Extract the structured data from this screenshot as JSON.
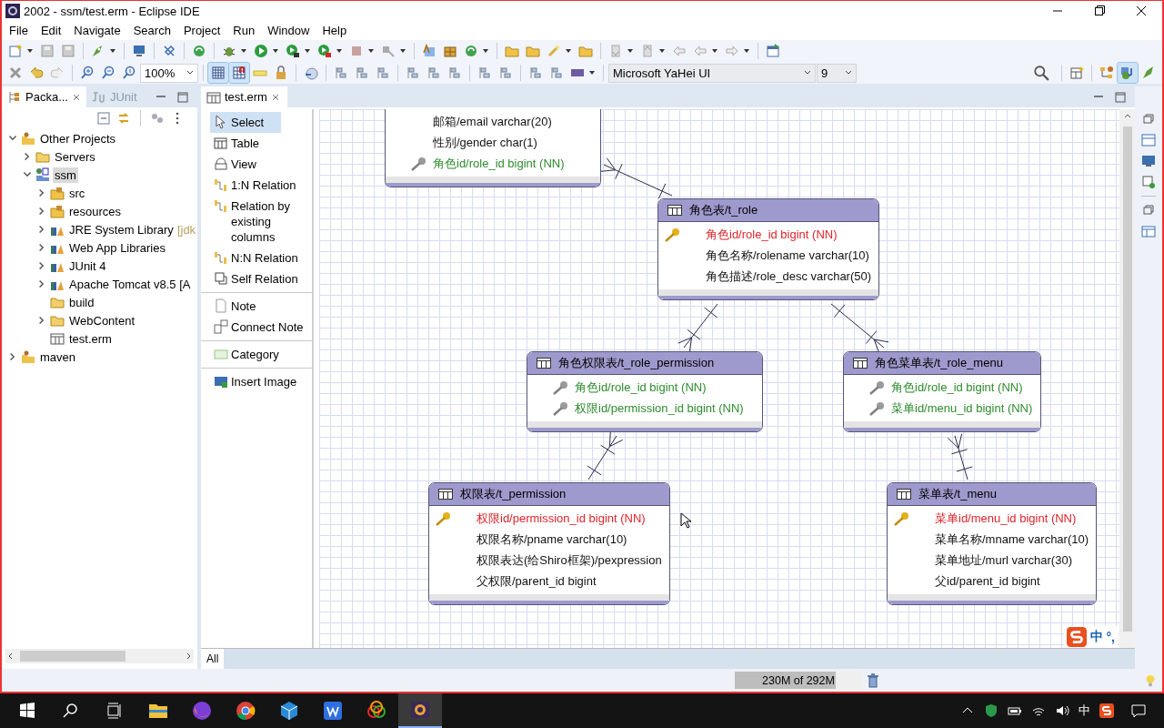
{
  "window": {
    "title": "2002 - ssm/test.erm - Eclipse IDE"
  },
  "menu": [
    "File",
    "Edit",
    "Navigate",
    "Search",
    "Project",
    "Run",
    "Window",
    "Help"
  ],
  "toolbar": {
    "zoom": "100%",
    "grid_shown": true,
    "snap_to_grid": true,
    "font": "Microsoft YaHei UI",
    "font_size": "9"
  },
  "perspectives": [
    {
      "selected": false
    },
    {
      "selected": true
    },
    {
      "selected": false
    }
  ],
  "left_tabs": [
    {
      "label": "Packa...",
      "selected": true
    },
    {
      "label": "JUnit",
      "selected": false
    }
  ],
  "tree": [
    {
      "label": "Other Projects",
      "kind": "working-set",
      "expanded": true,
      "selected": false,
      "children": [
        {
          "label": "Servers",
          "kind": "folder",
          "expanded": false,
          "selected": false
        },
        {
          "label": "ssm",
          "kind": "project",
          "expanded": true,
          "selected": true,
          "children": [
            {
              "label": "src",
              "kind": "package",
              "expanded": false,
              "selected": false
            },
            {
              "label": "resources",
              "kind": "package",
              "expanded": false,
              "selected": false
            },
            {
              "label": "JRE System Library",
              "decoration": "[jdk",
              "kind": "library",
              "expanded": false,
              "selected": false
            },
            {
              "label": "Web App Libraries",
              "kind": "library",
              "expanded": false,
              "selected": false
            },
            {
              "label": "JUnit 4",
              "kind": "library",
              "expanded": false,
              "selected": false
            },
            {
              "label": "Apache Tomcat v8.5 [A",
              "kind": "library",
              "expanded": false,
              "selected": false
            },
            {
              "label": "build",
              "kind": "folder",
              "selected": false
            },
            {
              "label": "WebContent",
              "kind": "folder",
              "expanded": false,
              "selected": false
            },
            {
              "label": "test.erm",
              "kind": "erm",
              "selected": false
            }
          ]
        }
      ]
    },
    {
      "label": "maven",
      "kind": "working-set",
      "expanded": false,
      "selected": false
    }
  ],
  "editor_tab": {
    "label": "test.erm",
    "selected": true
  },
  "palette": [
    [
      {
        "label": "Select",
        "kind": "select",
        "selected": true
      },
      {
        "label": "Table",
        "kind": "table",
        "selected": false
      },
      {
        "label": "View",
        "kind": "view",
        "selected": false
      },
      {
        "label": "1:N Relation",
        "kind": "relation",
        "selected": false
      },
      {
        "label": "Relation by existing columns",
        "kind": "relation",
        "selected": false
      },
      {
        "label": "N:N Relation",
        "kind": "nn",
        "selected": false
      },
      {
        "label": "Self Relation",
        "kind": "self",
        "selected": false
      }
    ],
    [
      {
        "label": "Note",
        "kind": "note",
        "selected": false
      },
      {
        "label": "Connect Note",
        "kind": "connect",
        "selected": false
      }
    ],
    [
      {
        "label": "Category",
        "kind": "category",
        "selected": false
      }
    ],
    [
      {
        "label": "Insert Image",
        "kind": "image",
        "selected": false
      }
    ]
  ],
  "tables": [
    {
      "columns": [
        {
          "text": "邮箱/email varchar(20)",
          "kind": "normal"
        },
        {
          "text": "性别/gender char(1)",
          "kind": "normal"
        },
        {
          "text": "角色id/role_id bigint (NN)",
          "kind": "fk"
        }
      ]
    },
    {
      "name": "角色表/t_role",
      "columns": [
        {
          "text": "角色id/role_id bigint (NN)",
          "kind": "pk"
        },
        {
          "text": "角色名称/rolename varchar(10)",
          "kind": "normal"
        },
        {
          "text": "角色描述/role_desc varchar(50)",
          "kind": "normal"
        }
      ]
    },
    {
      "name": "角色权限表/t_role_permission",
      "columns": [
        {
          "text": "角色id/role_id bigint (NN)",
          "kind": "fk"
        },
        {
          "text": "权限id/permission_id bigint (NN)",
          "kind": "fk"
        }
      ]
    },
    {
      "name": "角色菜单表/t_role_menu",
      "columns": [
        {
          "text": "角色id/role_id bigint (NN)",
          "kind": "fk"
        },
        {
          "text": "菜单id/menu_id bigint (NN)",
          "kind": "fk"
        }
      ]
    },
    {
      "name": "权限表/t_permission",
      "columns": [
        {
          "text": "权限id/permission_id bigint (NN)",
          "kind": "pk"
        },
        {
          "text": "权限名称/pname varchar(10)",
          "kind": "normal"
        },
        {
          "text": "权限表达(给Shiro框架)/pexpression",
          "kind": "normal"
        },
        {
          "text": "父权限/parent_id bigint",
          "kind": "normal"
        }
      ]
    },
    {
      "name": "菜单表/t_menu",
      "columns": [
        {
          "text": "菜单id/menu_id bigint (NN)",
          "kind": "pk"
        },
        {
          "text": "菜单名称/mname varchar(10)",
          "kind": "normal"
        },
        {
          "text": "菜单地址/murl varchar(30)",
          "kind": "normal"
        },
        {
          "text": "父id/parent_id bigint",
          "kind": "normal"
        }
      ]
    }
  ],
  "canvas_tabs": [
    {
      "label": "All",
      "selected": true
    }
  ],
  "ime_bar": {
    "mode": "中",
    "punct": "°,"
  },
  "memory": {
    "text": "230M of 292M",
    "level": 0.79
  },
  "taskbar_apps": [
    {
      "kind": "folder",
      "selected": false
    },
    {
      "kind": "fox",
      "selected": false
    },
    {
      "kind": "chrome",
      "selected": false
    },
    {
      "kind": "cube",
      "selected": false
    },
    {
      "kind": "writer",
      "selected": false
    },
    {
      "kind": "rings",
      "selected": false
    },
    {
      "kind": "ide",
      "selected": true
    }
  ],
  "tray": {
    "ime": "中"
  }
}
